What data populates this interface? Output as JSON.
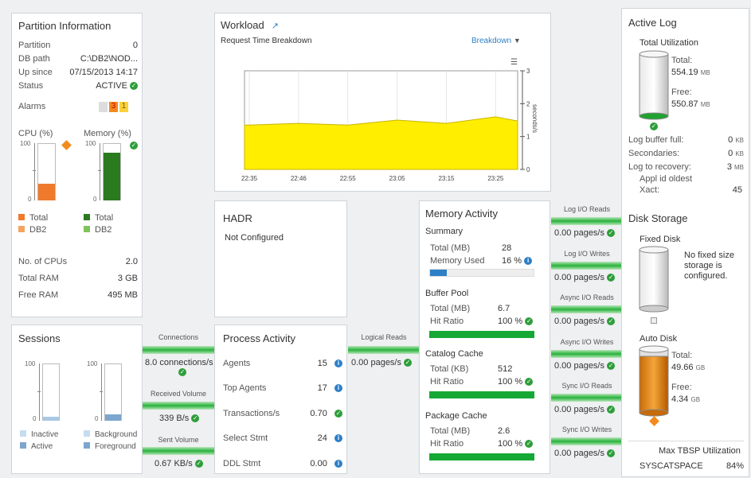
{
  "partition": {
    "title": "Partition Information",
    "rows": [
      {
        "label": "Partition",
        "value": "0"
      },
      {
        "label": "DB path",
        "value": "C:\\DB2\\NOD..."
      },
      {
        "label": "Up since",
        "value": "07/15/2013 14:17"
      },
      {
        "label": "Status",
        "value": "ACTIVE"
      }
    ],
    "alarms_label": "Alarms",
    "alarm_counts": [
      "3",
      "1"
    ],
    "cpu_title": "CPU (%)",
    "memory_title": "Memory (%)",
    "cpu_axis": [
      "100",
      "0"
    ],
    "mem_axis": [
      "100",
      "0"
    ],
    "cpu_fill": 0.3,
    "mem_fill": 0.85,
    "cpu_legend": [
      "Total",
      "DB2"
    ],
    "mem_legend": [
      "Total",
      "DB2"
    ],
    "stats": [
      {
        "label": "No. of CPUs",
        "value": "2.0"
      },
      {
        "label": "Total RAM",
        "value": "3 GB"
      },
      {
        "label": "Free RAM",
        "value": "495 MB"
      }
    ]
  },
  "workload": {
    "title": "Workload",
    "subtitle": "Request Time Breakdown",
    "breakdown_label": "Breakdown",
    "y_ticks": [
      "3",
      "2",
      "1",
      "0"
    ],
    "y_label": "seconds/s",
    "x_ticks": [
      "22:35",
      "22:46",
      "22:55",
      "23:05",
      "23:15",
      "23:25"
    ]
  },
  "chart_data": {
    "type": "area",
    "x": [
      "22:35",
      "22:46",
      "22:55",
      "23:05",
      "23:15",
      "23:25"
    ],
    "values": [
      1.35,
      1.4,
      1.35,
      1.5,
      1.4,
      1.6
    ],
    "ylim": [
      0,
      3
    ],
    "ylabel": "seconds/s",
    "color": "#ffee00"
  },
  "hadr": {
    "title": "HADR",
    "status": "Not Configured"
  },
  "sessions": {
    "title": "Sessions",
    "axis_left": [
      "100",
      "0"
    ],
    "axis_right": [
      "100",
      "0"
    ],
    "legend_left": [
      "Inactive",
      "Active"
    ],
    "legend_right": [
      "Background",
      "Foreground"
    ]
  },
  "flows_left": [
    {
      "label": "Connections",
      "value": "8.0 connections/s"
    },
    {
      "label": "Received Volume",
      "value": "339 B/s"
    },
    {
      "label": "Sent Volume",
      "value": "0.67 KB/s"
    }
  ],
  "process": {
    "title": "Process Activity",
    "rows": [
      {
        "label": "Agents",
        "value": "15"
      },
      {
        "label": "Top Agents",
        "value": "17"
      },
      {
        "label": "Transactions/s",
        "value": "0.70"
      },
      {
        "label": "Select Stmt",
        "value": "24"
      },
      {
        "label": "DDL Stmt",
        "value": "0.00"
      }
    ]
  },
  "logical": {
    "label": "Logical Reads",
    "value": "0.00 pages/s"
  },
  "memory": {
    "title": "Memory Activity",
    "summary_title": "Summary",
    "summary_total_label": "Total (MB)",
    "summary_total": "28",
    "memory_used_label": "Memory Used",
    "memory_used": "16 %",
    "memory_used_fraction": 0.16,
    "sections": [
      {
        "title": "Buffer Pool",
        "total_label": "Total (MB)",
        "total": "6.7",
        "hit_label": "Hit Ratio",
        "hit": "100 %"
      },
      {
        "title": "Catalog Cache",
        "total_label": "Total (KB)",
        "total": "512",
        "hit_label": "Hit Ratio",
        "hit": "100 %"
      },
      {
        "title": "Package Cache",
        "total_label": "Total (MB)",
        "total": "2.6",
        "hit_label": "Hit Ratio",
        "hit": "100 %"
      }
    ]
  },
  "io_flows": [
    {
      "label": "Log I/O Reads",
      "value": "0.00 pages/s"
    },
    {
      "label": "Log I/O Writes",
      "value": "0.00 pages/s"
    },
    {
      "label": "Async I/O Reads",
      "value": "0.00 pages/s"
    },
    {
      "label": "Async I/O Writes",
      "value": "0.00 pages/s"
    },
    {
      "label": "Sync I/O Reads",
      "value": "0.00 pages/s"
    },
    {
      "label": "Sync I/O Writes",
      "value": "0.00 pages/s"
    }
  ],
  "active_log": {
    "title": "Active Log",
    "util_title": "Total Utilization",
    "total_label": "Total:",
    "total_value": "554.19",
    "total_unit": "MB",
    "free_label": "Free:",
    "free_value": "550.87",
    "free_unit": "MB",
    "rows": [
      {
        "label": "Log buffer full:",
        "value": "0",
        "unit": "KB"
      },
      {
        "label": "Secondaries:",
        "value": "0",
        "unit": "KB"
      },
      {
        "label": "Log to recovery:",
        "value": "3",
        "unit": "MB"
      }
    ],
    "appl_label_1": "Appl id oldest",
    "appl_label_2": "Xact:",
    "appl_value": "45"
  },
  "disk": {
    "title": "Disk Storage",
    "fixed_title": "Fixed Disk",
    "fixed_msg": "No fixed size storage is configured.",
    "auto_title": "Auto Disk",
    "total_label": "Total:",
    "total_value": "49.66",
    "total_unit": "GB",
    "free_label": "Free:",
    "free_value": "4.34",
    "free_unit": "GB",
    "tbsp_title": "Max TBSP Utilization",
    "tbsp_name": "SYSCATSPACE",
    "tbsp_value": "84%"
  },
  "colors": {
    "cpu_total": "#f07a2c",
    "cpu_db2": "#f4a460",
    "mem_total": "#2a7a1e",
    "mem_db2": "#7ec35a",
    "green_bar": "#16a835",
    "yellow": "#ffee00",
    "blue": "#2d7fc6"
  }
}
